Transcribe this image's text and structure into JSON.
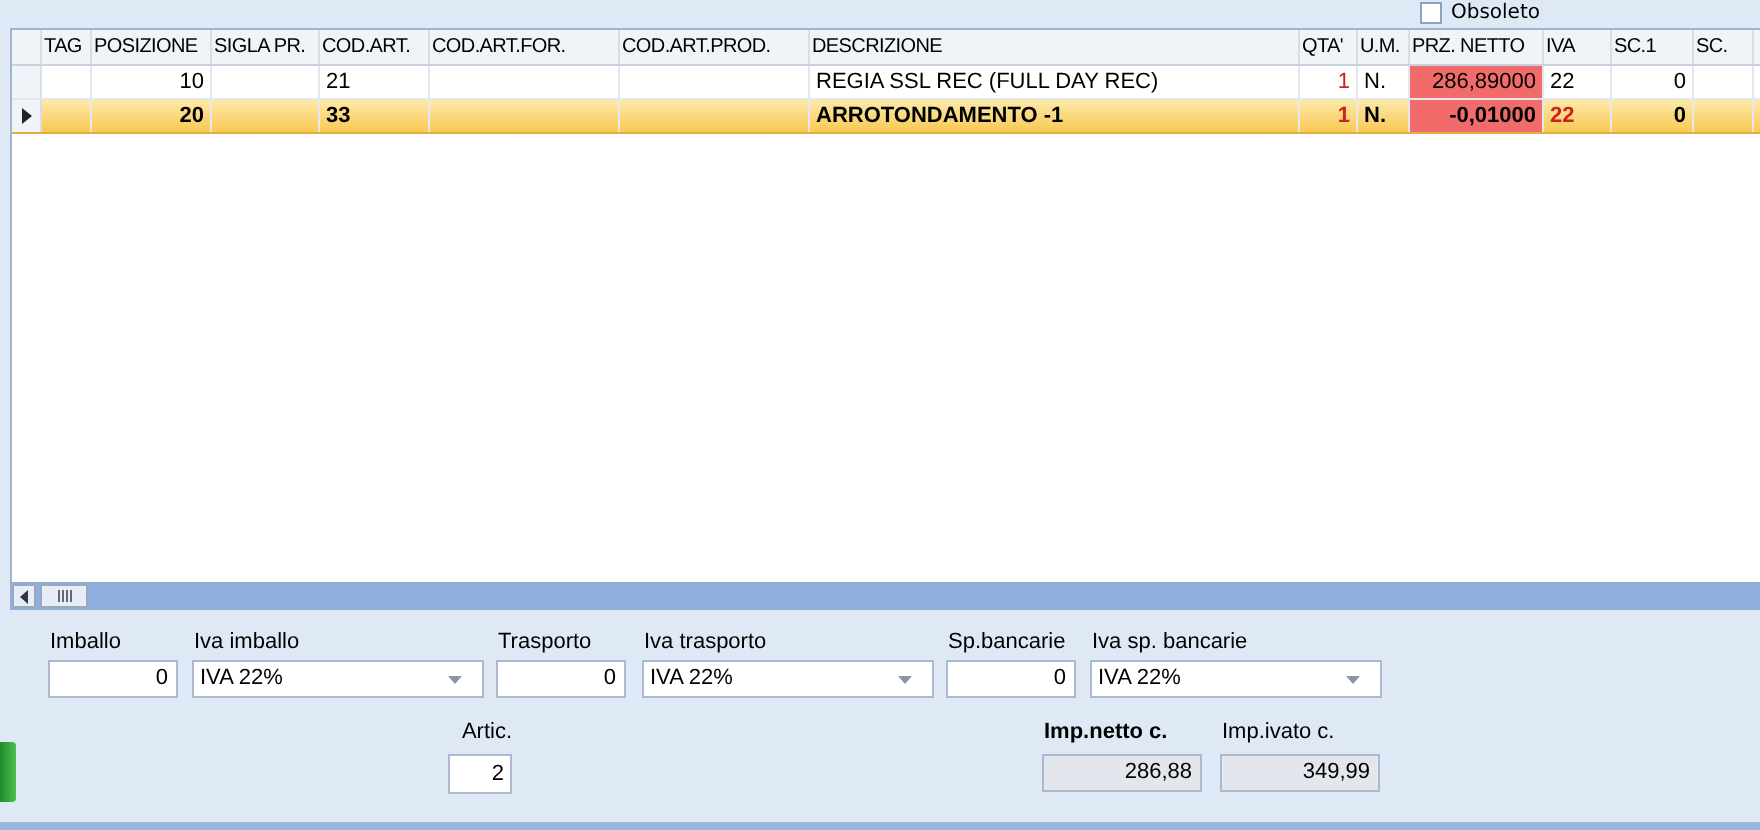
{
  "filter": {
    "label": "Obsoleto",
    "checked": false
  },
  "table": {
    "columns": [
      "TAG",
      "POSIZIONE",
      "SIGLA PR.",
      "COD.ART.",
      "COD.ART.FOR.",
      "COD.ART.PROD.",
      "DESCRIZIONE",
      "QTA'",
      "U.M.",
      "PRZ. NETTO",
      "IVA",
      "SC.1",
      "SC."
    ],
    "rows": [
      {
        "selected": false,
        "cells": [
          "",
          "10",
          "",
          "21",
          "",
          "",
          "REGIA SSL REC (FULL DAY REC)",
          "1",
          "N.",
          "286,89000",
          "22",
          "0",
          ""
        ]
      },
      {
        "selected": true,
        "cells": [
          "",
          "20",
          "",
          "33",
          "",
          "",
          "ARROTONDAMENTO -1",
          "1",
          "N.",
          "-0,01000",
          "22",
          "0",
          ""
        ]
      }
    ]
  },
  "form": {
    "row_1": [
      {
        "kind": "input",
        "label": "Imballo",
        "value": "0"
      },
      {
        "kind": "select",
        "label": "Iva imballo",
        "value": "IVA 22%"
      },
      {
        "kind": "input",
        "label": "Trasporto",
        "value": "0"
      },
      {
        "kind": "select",
        "label": "Iva trasporto",
        "value": "IVA 22%"
      },
      {
        "kind": "input",
        "label": "Sp.bancarie",
        "value": "0"
      },
      {
        "kind": "select",
        "label": "Iva sp. bancarie",
        "value": "IVA 22%"
      }
    ],
    "articles": {
      "label": "Artic.",
      "value": "2"
    },
    "totals": [
      {
        "label": "Imp.netto c.",
        "value": "286,88",
        "bold": true
      },
      {
        "label": "Imp.ivato c.",
        "value": "349,99",
        "bold": false
      }
    ]
  }
}
